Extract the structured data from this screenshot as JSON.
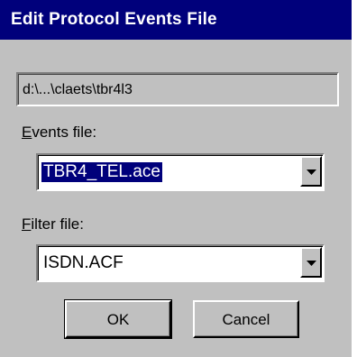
{
  "window": {
    "title": "Edit Protocol Events File"
  },
  "path": {
    "value": "d:\\...\\claets\\tbr4l3"
  },
  "events": {
    "label_mnemonic": "E",
    "label_rest": "vents file:",
    "value": "TBR4_TEL.ace",
    "selected": true
  },
  "filter": {
    "label_mnemonic": "F",
    "label_rest": "ilter file:",
    "value": "ISDN.ACF"
  },
  "buttons": {
    "ok_label": "OK",
    "cancel_label": "Cancel"
  },
  "colors": {
    "titlebar": "#00007b",
    "dialog_face": "#c0c0c0",
    "selection": "#00007b"
  },
  "icons": {
    "dropdown_arrow": "chevron-down-icon"
  }
}
